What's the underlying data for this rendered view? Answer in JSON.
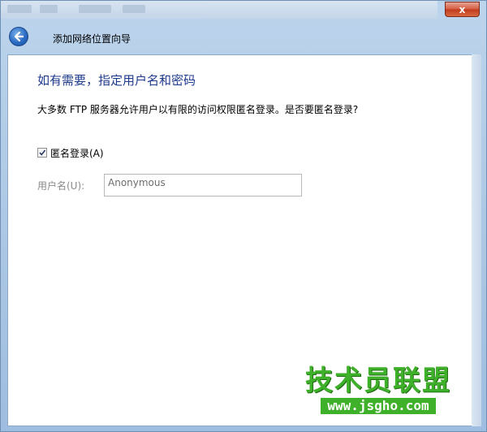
{
  "window": {
    "close_glyph": "x"
  },
  "header": {
    "title": "添加网络位置向导"
  },
  "page": {
    "heading": "如有需要，指定用户名和密码",
    "description": "大多数 FTP 服务器允许用户以有限的访问权限匿名登录。是否要匿名登录?"
  },
  "anonymous_checkbox": {
    "checked": true,
    "label": "匿名登录(A)"
  },
  "username": {
    "label": "用户名(U):",
    "value": "Anonymous"
  },
  "watermark": {
    "main": "技术员联盟",
    "url": "www.jsgho.com"
  },
  "colors": {
    "heading": "#1e3a8c",
    "watermark_green": "#3fb02a",
    "close_red": "#c0391b"
  },
  "icons": {
    "back": "back-arrow-icon",
    "close": "close-icon",
    "check": "checkmark-icon"
  }
}
